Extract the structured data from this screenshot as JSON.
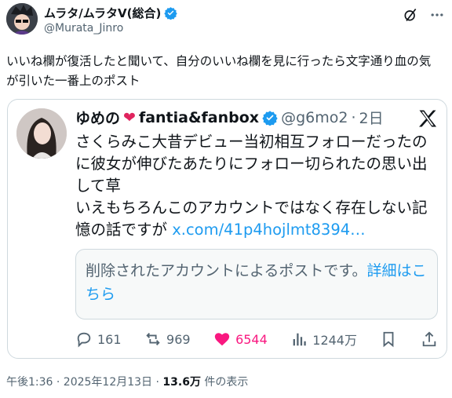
{
  "author": {
    "name": "ムラタ/ムラタV(総合)",
    "handle": "@Murata_Jinro"
  },
  "post": {
    "text": "いいね欄が復活したと聞いて、自分のいいね欄を見に行ったら文字通り血の気が引いた一番上のポスト"
  },
  "quote": {
    "name": "ゆめの",
    "name_suffix": "fantia&fanbox",
    "handle": "@g6mo2",
    "separator": "·",
    "age": "2日",
    "text": "さくらみこ大昔デビュー当初相互フォローだったのに彼女が伸びたあたりにフォロー切られたの思い出して草\nいえもちろんこのアカウントではなく存在しない記憶の話ですが ",
    "link": "x.com/41p4hojlmt8394…",
    "deleted_text": "削除されたアカウントによるポストです。",
    "deleted_link": "詳細はこちら",
    "replies": "161",
    "reposts": "969",
    "likes": "6544",
    "views": "1244万"
  },
  "meta": {
    "time": "午後1:36 · 2025年12月13日 · ",
    "views_count": "13.6万",
    "views_label": " 件の表示"
  },
  "colors": {
    "accent": "#1d9bf0",
    "like": "#f91880",
    "muted": "#536471",
    "text": "#0f1419"
  }
}
